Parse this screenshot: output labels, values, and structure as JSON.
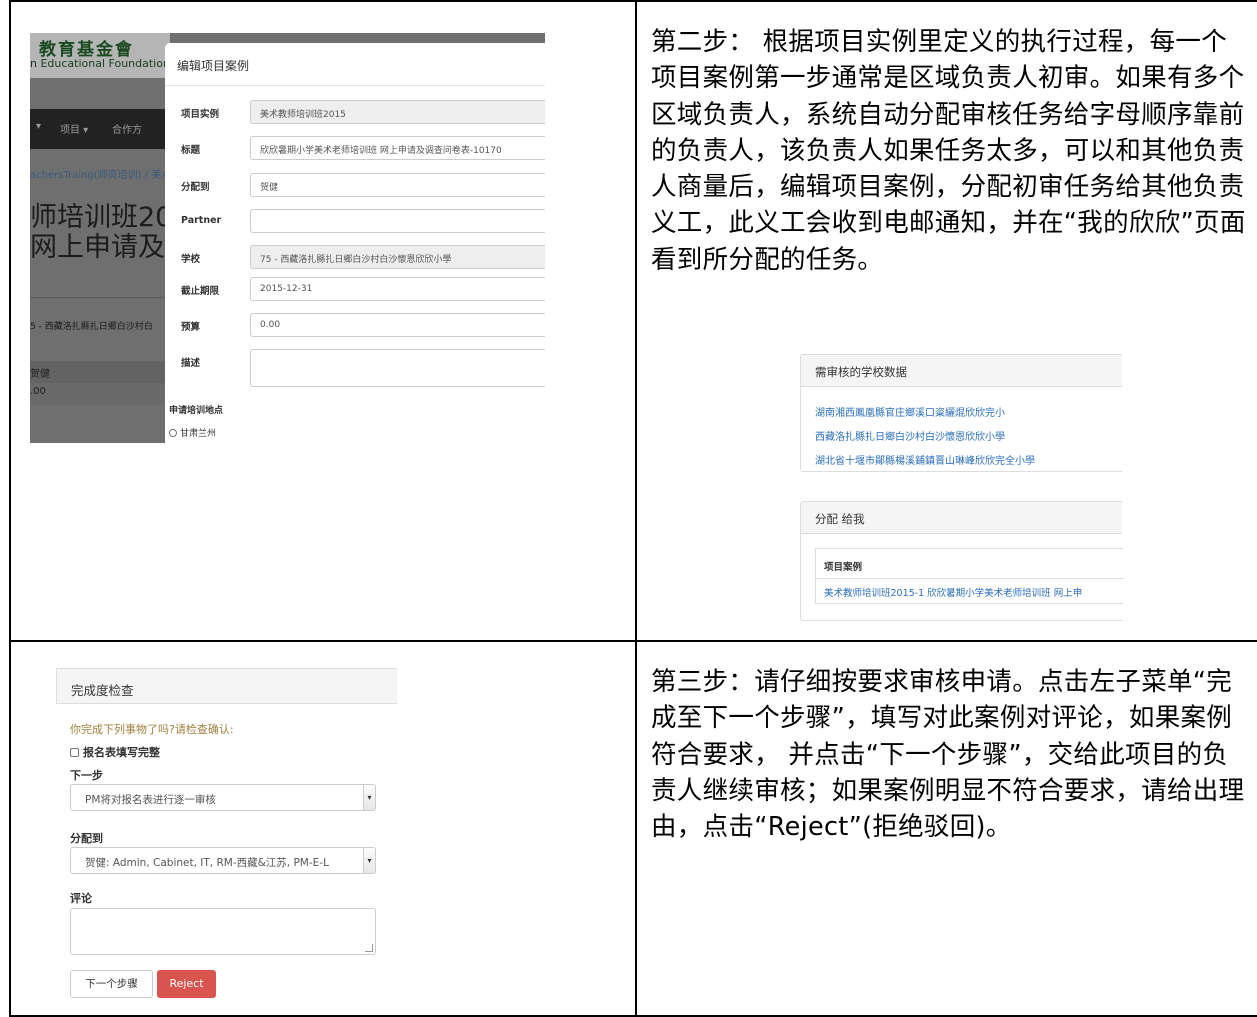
{
  "step2": {
    "text": "第二步： 根据项目实例里定义的执行过程，每一个项目案例第一步通常是区域负责人初审。如果有多个区域负责人，系统自动分配审核任务给字母顺序靠前的负责人，该负责人如果任务太多，可以和其他负责人商量后，编辑项目案例，分配初审任务给其他负责义工，此义工会收到电邮通知，并在“我的欣欣”页面看到所分配的任务。"
  },
  "step3": {
    "text": "第三步：请仔细按要求审核申请。点击左子菜单“完成至下一个步骤”，填写对此案例对评论，如果案例符合要求， 并点击“下一个步骤”，交给此项目的负责人继续审核；如果案例明显不符合要求，请给出理由，点击“Reject”(拒绝驳回)。"
  },
  "edit_screenshot": {
    "background": {
      "logo_cn": "教育基金會",
      "logo_en": "n Educational Foundation",
      "nav_items": [
        "▾",
        "项目 ▾",
        "合作方"
      ],
      "breadcrumb": "achersTraing(师资培训) / 美术",
      "title_line1": "师培训班20",
      "title_line2": "网上申请及调",
      "school": "5 - 西藏洛扎縣扎日鄉白沙村白",
      "name": "贺健",
      "amount": ".00"
    },
    "modal": {
      "title": "编辑项目案例",
      "fields": [
        {
          "label": "项目实例",
          "value": "美术教师培训班2015"
        },
        {
          "label": "标题",
          "value": "欣欣暑期小学美术老师培训班 网上申请及调查问卷表-10170"
        },
        {
          "label": "分配到",
          "value": "贺健"
        },
        {
          "label": "Partner",
          "value": ""
        },
        {
          "label": "学校",
          "value": "75 - 西藏洛扎縣扎日鄉白沙村白沙懷恩欣欣小學"
        },
        {
          "label": "截止期限",
          "value": "2015-12-31"
        },
        {
          "label": "预算",
          "value": "0.00"
        },
        {
          "label": "描述",
          "value": ""
        }
      ],
      "apply_location_label": "申请培训地点",
      "apply_location_option": "甘肃兰州"
    }
  },
  "sidebar_screenshot": {
    "review_panel": {
      "title": "需审核的学校数据",
      "links": [
        "湖南湘西鳳凰縣官庄鄉溪口粢纚焜欣欣完小",
        "西藏洛扎縣扎日鄉白沙村白沙懷恩欣欣小學",
        "湖北省十堰市鄖縣楊溪鋪鎮晋山琳峰欣欣完全小學"
      ]
    },
    "assigned_panel": {
      "title": "分配 给我",
      "column_header": "项目案例",
      "row_link": "美术教师培训班2015-1 欣欣暑期小学美术老师培训班 网上申"
    }
  },
  "check_screenshot": {
    "title": "完成度检查",
    "prompt": "你完成下列事物了吗?请检查确认:",
    "checkbox_label": "报名表填写完整",
    "next_step_label": "下一步",
    "next_step_value": "PM将对报名表进行逐一审核",
    "assign_label": "分配到",
    "assign_value": "贺健: Admin, Cabinet, IT, RM-西藏&江苏, PM-E-L",
    "comment_label": "评论",
    "next_button": "下一个步骤",
    "reject_button": "Reject"
  },
  "colors": {
    "link": "#2a6ebd",
    "danger": "#d9534f",
    "warning_text": "#a0813c"
  }
}
